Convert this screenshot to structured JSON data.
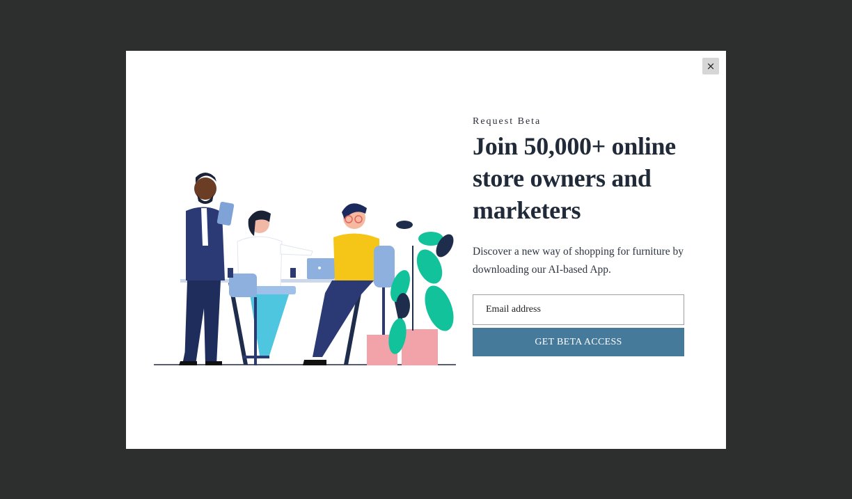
{
  "modal": {
    "close_label": "×",
    "eyebrow": "Request Beta",
    "headline": "Join 50,000+ online store owners and marketers",
    "description": "Discover a new way of shopping for furniture by downloading our AI-based App.",
    "email_placeholder": "Email address",
    "cta_label": "GET BETA ACCESS"
  },
  "colors": {
    "overlay": "#2d2e2e",
    "button": "#467a9b",
    "heading": "#212a38"
  }
}
